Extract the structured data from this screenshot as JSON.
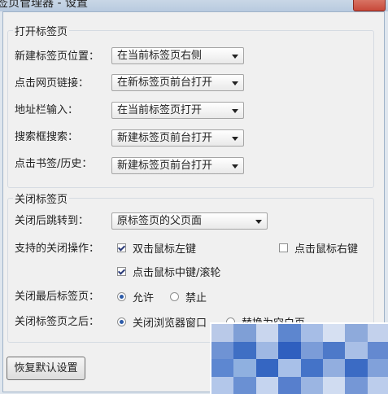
{
  "window": {
    "title": "签页管理器 - 设置"
  },
  "open_group": {
    "title": "打开标签页",
    "rows": [
      {
        "label": "新建标签页位置：",
        "value": "在当前标签页右侧"
      },
      {
        "label": "点击网页链接：",
        "value": "在新标签页前台打开"
      },
      {
        "label": "地址栏输入：",
        "value": "在当前标签页打开"
      },
      {
        "label": "搜索框搜索：",
        "value": "新建标签页前台打开"
      },
      {
        "label": "点击书签/历史：",
        "value": "新建标签页前台打开"
      }
    ]
  },
  "close_group": {
    "title": "关闭标签页",
    "jump": {
      "label": "关闭后跳转到：",
      "value": "原标签页的父页面"
    },
    "ops": {
      "label": "支持的关闭操作：",
      "double_click": {
        "label": "双击鼠标左键",
        "checked": true
      },
      "right_click": {
        "label": "点击鼠标右键",
        "checked": false
      },
      "middle_click": {
        "label": "点击鼠标中键/滚轮",
        "checked": true
      }
    },
    "last_tab": {
      "label": "关闭最后标签页：",
      "allow": "允许",
      "forbid": "禁止",
      "selected": "允许"
    },
    "after_close": {
      "label": "关闭标签页之后：",
      "option1": "关闭浏览器窗口",
      "option2": "替换为空白页",
      "selected": "关闭浏览器窗口"
    }
  },
  "footer": {
    "reset_label": "恢复默认设置"
  },
  "colors": {
    "accent": "#2b5aa8",
    "window_bg": "#f0f0f0",
    "titlebar": "#c9d7e6"
  }
}
